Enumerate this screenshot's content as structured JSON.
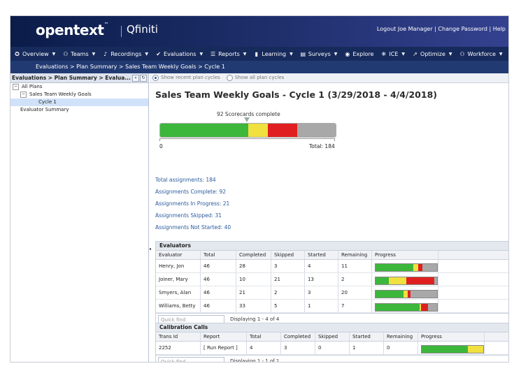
{
  "brand": {
    "logo": "opentext",
    "logo_tm": "™",
    "product": "Qfiniti"
  },
  "top_links": {
    "logout": "Logout Joe Manager",
    "sep": " | ",
    "change_password": "Change Password",
    "help": "Help"
  },
  "nav": [
    {
      "label": "Overview",
      "icon": "compass-icon"
    },
    {
      "label": "Teams",
      "icon": "people-icon"
    },
    {
      "label": "Recordings",
      "icon": "microphone-icon"
    },
    {
      "label": "Evaluations",
      "icon": "checkmark-icon"
    },
    {
      "label": "Reports",
      "icon": "list-icon"
    },
    {
      "label": "Learning",
      "icon": "book-icon"
    },
    {
      "label": "Surveys",
      "icon": "chat-icon"
    },
    {
      "label": "Explore",
      "icon": "explore-icon"
    },
    {
      "label": "ICE",
      "icon": "ice-icon"
    },
    {
      "label": "Optimize",
      "icon": "optimize-icon"
    },
    {
      "label": "Workforce",
      "icon": "workforce-icon"
    }
  ],
  "breadcrumb": "Evaluations > Plan Summary > Sales Team Weekly Goals > Cycle 1",
  "left_panel": {
    "header": "Evaluations > Plan Summary > Evalua...",
    "tree": [
      {
        "label": "All Plans",
        "level": 0,
        "toggle": "−"
      },
      {
        "label": "Sales Team Weekly Goals",
        "level": 1,
        "toggle": "−"
      },
      {
        "label": "Cycle 1",
        "level": 2,
        "selected": true
      },
      {
        "label": "Evaluator Summary",
        "level": 0
      }
    ]
  },
  "options": {
    "recent": "Show recent plan cycles",
    "all": "Show all plan cycles"
  },
  "title": "Sales Team Weekly Goals - Cycle 1 (3/29/2018 - 4/4/2018)",
  "summary_bar": {
    "label": "92 Scorecards complete",
    "zero": "0",
    "total_label": "Total: 184",
    "total": 184,
    "segments": [
      {
        "name": "complete",
        "value": 92,
        "color": "#3cb73c"
      },
      {
        "name": "in-progress",
        "value": 21,
        "color": "#f0e040"
      },
      {
        "name": "skipped",
        "value": 31,
        "color": "#e02020"
      },
      {
        "name": "not-started",
        "value": 40,
        "color": "#a8a8a8"
      }
    ]
  },
  "stats": {
    "total": "Total assignments: 184",
    "complete": "Assignments Complete: 92",
    "in_progress": "Assignments In Progress: 21",
    "skipped": "Assignments Skipped: 31",
    "not_started": "Assignments Not Started: 40"
  },
  "evaluators": {
    "title": "Evaluators",
    "columns": [
      "Evaluator",
      "Total",
      "Completed",
      "Skipped",
      "Started",
      "Remaining",
      "Progress"
    ],
    "rows": [
      {
        "evaluator": "Henry, Jon",
        "total": "46",
        "completed": "28",
        "skipped": "3",
        "started": "4",
        "remaining": "11",
        "progress": [
          28,
          4,
          3,
          11
        ]
      },
      {
        "evaluator": "Joiner, Mary",
        "total": "46",
        "completed": "10",
        "skipped": "21",
        "started": "13",
        "remaining": "2",
        "progress": [
          10,
          13,
          21,
          2
        ]
      },
      {
        "evaluator": "Smyers, Alan",
        "total": "46",
        "completed": "21",
        "skipped": "2",
        "started": "3",
        "remaining": "20",
        "progress": [
          21,
          3,
          2,
          20
        ]
      },
      {
        "evaluator": "Williams, Betty",
        "total": "46",
        "completed": "33",
        "skipped": "5",
        "started": "1",
        "remaining": "7",
        "progress": [
          33,
          1,
          5,
          7
        ]
      }
    ],
    "quick_find": "Quick find",
    "displaying": "Displaying 1 - 4 of 4"
  },
  "calibration": {
    "title": "Calibration Calls",
    "columns": [
      "Trans Id",
      "Report",
      "Total",
      "Completed",
      "Skipped",
      "Started",
      "Remaining",
      "Progress"
    ],
    "rows": [
      {
        "trans_id": "2252",
        "report": "[ Run Report ]",
        "total": "4",
        "completed": "3",
        "skipped": "0",
        "started": "1",
        "remaining": "0",
        "progress": [
          3,
          1,
          0,
          0
        ]
      }
    ],
    "quick_find": "Quick find",
    "displaying": "Displaying 1 - 1 of 1"
  },
  "colors": {
    "complete": "#3cb73c",
    "started": "#f0e040",
    "skipped": "#e02020",
    "remaining": "#a8a8a8",
    "header": "#0b1c4a"
  }
}
